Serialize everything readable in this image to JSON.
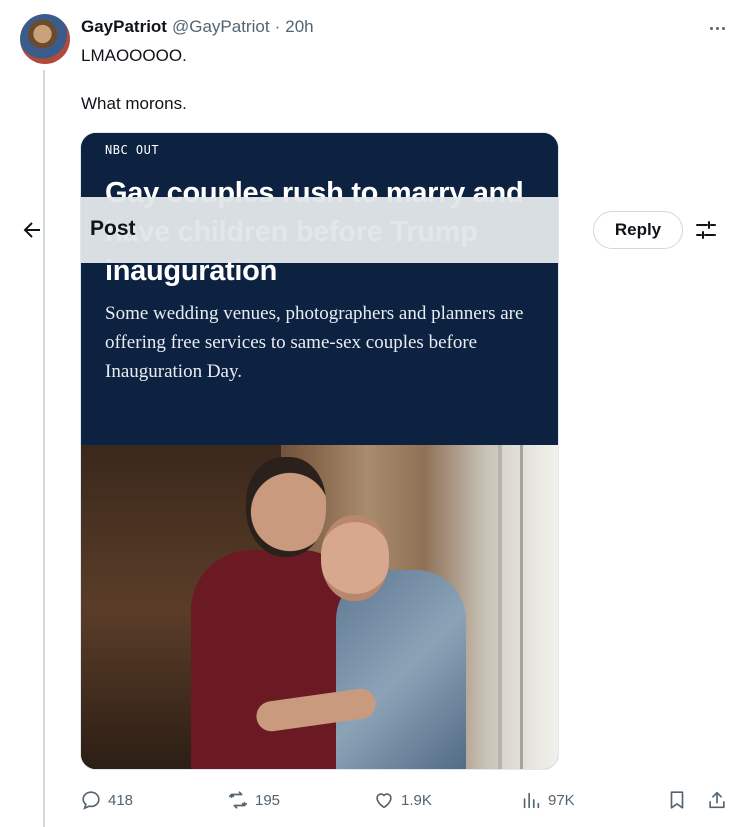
{
  "tweet": {
    "display_name": "GayPatriot",
    "handle": "@GayPatriot",
    "separator": "·",
    "time": "20h",
    "text": "LMAOOOOO.\n\nWhat morons."
  },
  "card": {
    "source": "NBC OUT",
    "headline": "Gay couples rush to marry and have children before Trump inauguration",
    "subhead": "Some wedding venues, photographers and planners are offering free services to same-sex couples before Inauguration Day."
  },
  "topbar": {
    "title": "Post",
    "reply_label": "Reply"
  },
  "actions": {
    "replies": "418",
    "reposts": "195",
    "likes": "1.9K",
    "views": "97K"
  },
  "icons": {
    "more": "more-horizontal-icon",
    "back": "arrow-left-icon",
    "filter": "sliders-icon",
    "reply": "reply-icon",
    "repost": "repost-icon",
    "like": "heart-icon",
    "views": "analytics-icon",
    "bookmark": "bookmark-icon",
    "share": "share-icon"
  },
  "colors": {
    "secondary_text": "#536471",
    "card_navy": "#0d2240",
    "border": "#cfd9de"
  }
}
